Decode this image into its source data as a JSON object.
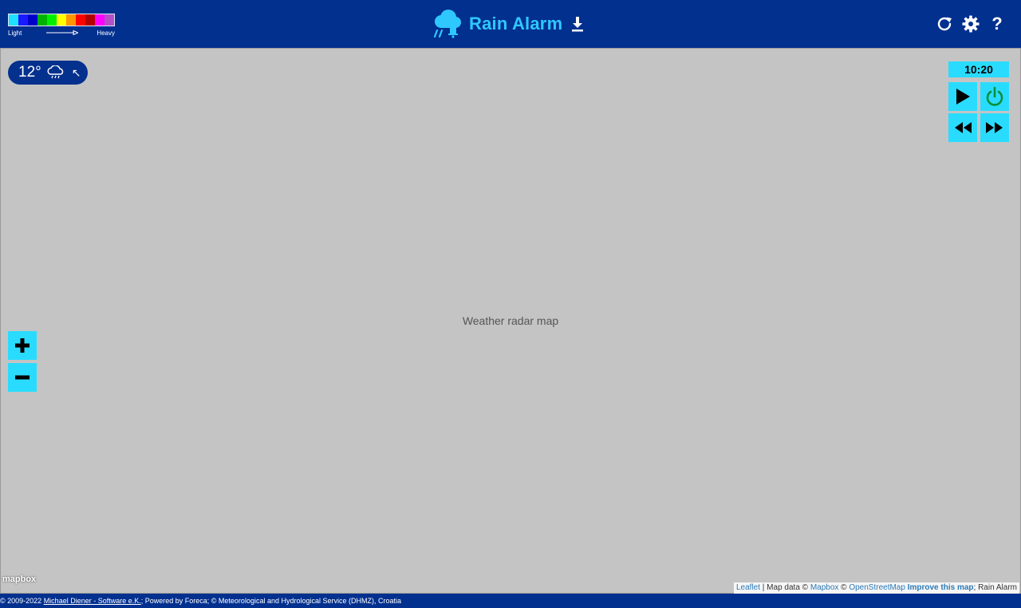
{
  "legend": {
    "colors": [
      "#1ee0ff",
      "#1a1aff",
      "#0000c8",
      "#00b400",
      "#00f000",
      "#ffff00",
      "#ff9600",
      "#ff0000",
      "#b40000",
      "#ff00ff",
      "#b450c8"
    ],
    "light_label": "Light",
    "heavy_label": "Heavy"
  },
  "header": {
    "title": "Rain Alarm",
    "logo_icon": "rain-cloud-bell-icon",
    "download_icon": "download-icon",
    "refresh_icon": "refresh-icon",
    "settings_icon": "gear-icon",
    "help_label": "?"
  },
  "weather": {
    "temperature": "12°",
    "condition_icon": "cloud-rain-icon",
    "location_arrow": "↖"
  },
  "playback": {
    "time": "10:20"
  },
  "map": {
    "placeholder_tag": "Weather radar map"
  },
  "attribution": {
    "leaflet": "Leaflet",
    "sep1": " | Map data © ",
    "mapbox": "Mapbox",
    "sep2": " © ",
    "osm": "OpenStreetMap",
    "sep3": " ",
    "improve": "Improve this map",
    "end": "; Rain Alarm"
  },
  "mapbox_logo": "mapbox",
  "footer": {
    "prefix": "© 2009-2022 ",
    "author": "Michael Diener - Software e.K.",
    "rest": "; Powered by Foreca; © Meteorological and Hydrological Service (DHMZ), Croatia"
  }
}
